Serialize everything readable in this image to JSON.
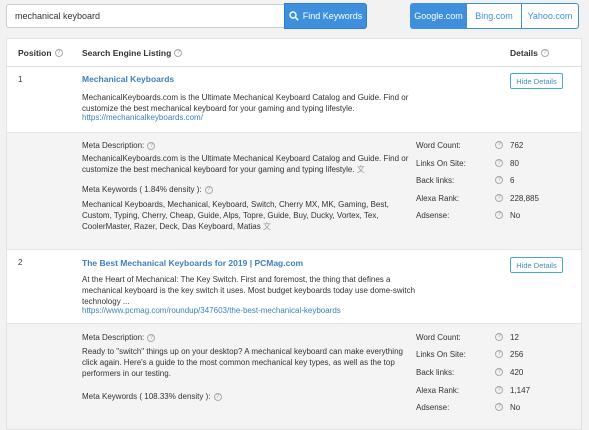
{
  "search": {
    "value": "mechanical keyboard",
    "button_label": "Find Keywords"
  },
  "engines": [
    {
      "label": "Google.com",
      "active": true
    },
    {
      "label": "Bing.com",
      "active": false
    },
    {
      "label": "Yahoo.com",
      "active": false
    }
  ],
  "table": {
    "headers": {
      "position": "Position",
      "listing": "Search Engine Listing",
      "details": "Details"
    },
    "hide_label": "Hide Details",
    "stat_labels": [
      "Word Count:",
      "Links On Site:",
      "Back links:",
      "Alexa Rank:",
      "Adsense:"
    ],
    "meta_description_label": "Meta Description:",
    "results": [
      {
        "position": "1",
        "title": "Mechanical Keyboards",
        "snippet": "MechanicalKeyboards.com is the Ultimate Mechanical Keyboard Catalog and Guide. Find or customize the best mechanical keyboard for your gaming and typing lifestyle.",
        "url": "https://mechanicalkeyboards.com/",
        "meta_description": "MechanicalKeyboards.com is the Ultimate Mechanical Keyboard Catalog and Guide. Find or customize the best mechanical keyboard for your gaming and typing lifestyle.",
        "meta_keywords_label": "Meta Keywords ( 1.84% density ):",
        "meta_keywords": "Mechanical Keyboards, Mechanical, Keyboard, Switch, Cherry MX, MK, Gaming, Best, Custom, Typing, Cherry, Cheap, Guide, Alps, Topre, Guide, Buy, Ducky, Vortex, Tex, CoolerMaster, Razer, Deck, Das Keyboard, Matias",
        "stats": [
          "762",
          "80",
          "6",
          "228,885",
          "No"
        ]
      },
      {
        "position": "2",
        "title": "The Best Mechanical Keyboards for 2019 | PCMag.com",
        "snippet": "At the Heart of Mechanical: The Key Switch. First and foremost, the thing that defines a mechanical keyboard is the key switch it uses. Most budget keyboards today use dome-switch technology ...",
        "url": "https://www.pcmag.com/roundup/347603/the-best-mechanical-keyboards",
        "meta_description": "Ready to \"switch\" things up on your desktop? A mechanical keyboard can make everything click again. Here's a guide to the most common mechanical key types, as well as the top performers in our testing.",
        "meta_keywords_label": "Meta Keywords ( 108.33% density ):",
        "meta_keywords": "",
        "stats": [
          "12",
          "256",
          "420",
          "1,147",
          "No"
        ]
      }
    ]
  }
}
